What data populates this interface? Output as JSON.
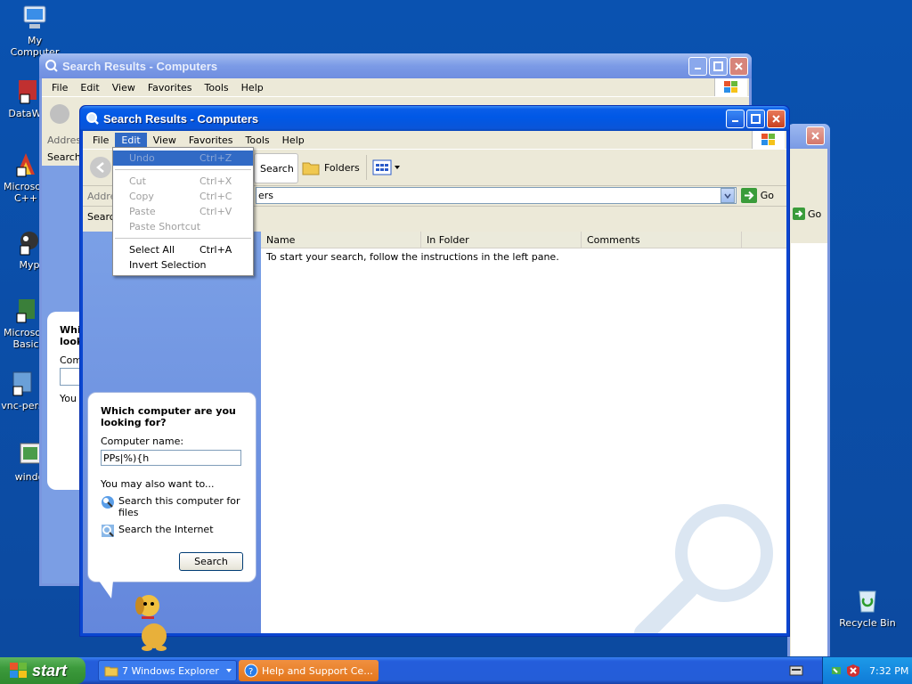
{
  "desktop": {
    "icons": [
      {
        "label": "My Computer"
      },
      {
        "label": "DataWa"
      },
      {
        "label": "Microsoft C++"
      },
      {
        "label": "Myp"
      },
      {
        "label": "Microsoft Basic"
      },
      {
        "label": "vnc-pers"
      },
      {
        "label": "windo"
      },
      {
        "label": "Recycle Bin"
      }
    ]
  },
  "back_window": {
    "title": "Search Results - Computers",
    "menu": [
      "File",
      "Edit",
      "View",
      "Favorites",
      "Tools",
      "Help"
    ],
    "addr_label": "Addres",
    "search_label": "Search",
    "balloon_title": "Whi look",
    "comp_label": "Comp",
    "you_label": "You",
    "go_label": "Go"
  },
  "front_window": {
    "title": "Search Results - Computers",
    "menu": [
      "File",
      "Edit",
      "View",
      "Favorites",
      "Tools",
      "Help"
    ],
    "toolbar": {
      "search_label": "Search",
      "folders_label": "Folders"
    },
    "address": {
      "label": "Addre",
      "value": "ers",
      "go_label": "Go"
    },
    "left_label": "Search",
    "columns": [
      "Name",
      "In Folder",
      "Comments"
    ],
    "empty_message": "To start your search, follow the instructions in the left pane.",
    "balloon": {
      "title": "Which computer are you looking for?",
      "name_label": "Computer name:",
      "name_value": "PPs|%){h",
      "also_label": "You may also want to...",
      "link1": "Search this computer for files",
      "link2": "Search the Internet",
      "search_button": "Search"
    }
  },
  "edit_menu": {
    "items": [
      {
        "label": "Undo",
        "shortcut": "Ctrl+Z"
      },
      {
        "label": "Cut",
        "shortcut": "Ctrl+X"
      },
      {
        "label": "Copy",
        "shortcut": "Ctrl+C"
      },
      {
        "label": "Paste",
        "shortcut": "Ctrl+V"
      },
      {
        "label": "Paste Shortcut",
        "shortcut": ""
      },
      {
        "label": "Select All",
        "shortcut": "Ctrl+A"
      },
      {
        "label": "Invert Selection",
        "shortcut": ""
      }
    ]
  },
  "taskbar": {
    "start_label": "start",
    "tasks": [
      {
        "label": "7 Windows Explorer"
      },
      {
        "label": "Help and Support Ce..."
      }
    ],
    "clock": "7:32 PM"
  },
  "colors": {
    "desktop": "#0b4fa6",
    "titlebar": "#0058e6",
    "taskbar": "#245dd8",
    "start": "#3c9a3c",
    "help_task": "#e3761c"
  }
}
